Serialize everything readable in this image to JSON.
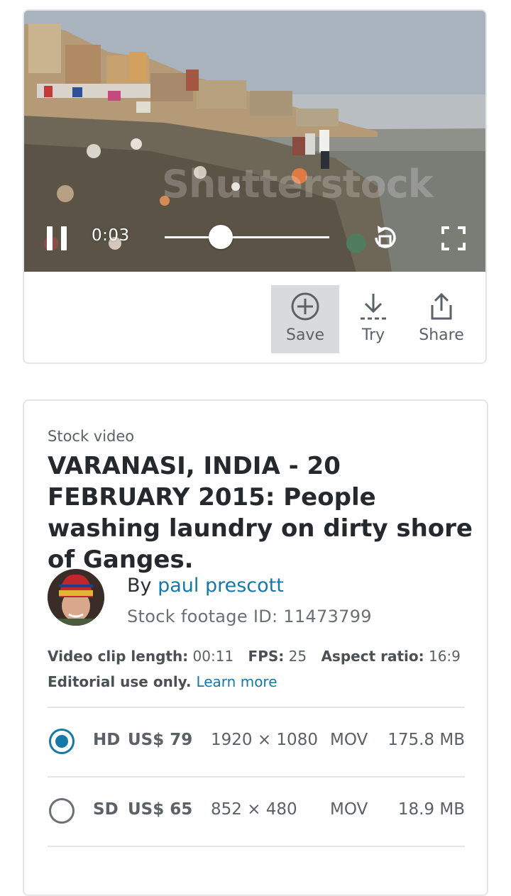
{
  "player": {
    "timecode": "0:03",
    "progress": 0.34,
    "watermark": "Shutterstock"
  },
  "actions": [
    {
      "label": "Save",
      "icon": "plus-circle-icon",
      "active": true
    },
    {
      "label": "Try",
      "icon": "download-icon"
    },
    {
      "label": "Share",
      "icon": "share-icon"
    }
  ],
  "details": {
    "eyebrow": "Stock video",
    "title": "VARANASI, INDIA - 20 FEBRUARY 2015: People washing laundry on dirty shore of Ganges.",
    "by_prefix": "By ",
    "author": "paul prescott",
    "stock_id": "Stock footage ID: 11473799",
    "meta": {
      "length_label": "Video clip length:",
      "length_value": "00:11",
      "fps_label": "FPS:",
      "fps_value": "25",
      "aspect_label": "Aspect ratio:",
      "aspect_value": "16:9"
    },
    "editorial": "Editorial use only.",
    "learn_more": "Learn more"
  },
  "options": [
    {
      "quality": "HD",
      "price": "US$ 79",
      "resolution": "1920 × 1080",
      "format": "MOV",
      "size": "175.8 MB",
      "selected": true
    },
    {
      "quality": "SD",
      "price": "US$ 65",
      "resolution": "852 × 480",
      "format": "MOV",
      "size": "18.9 MB",
      "selected": false
    }
  ],
  "colors": {
    "link": "#1479a8",
    "save_active_bg": "#d9dadb",
    "border": "#e3e5e7"
  }
}
